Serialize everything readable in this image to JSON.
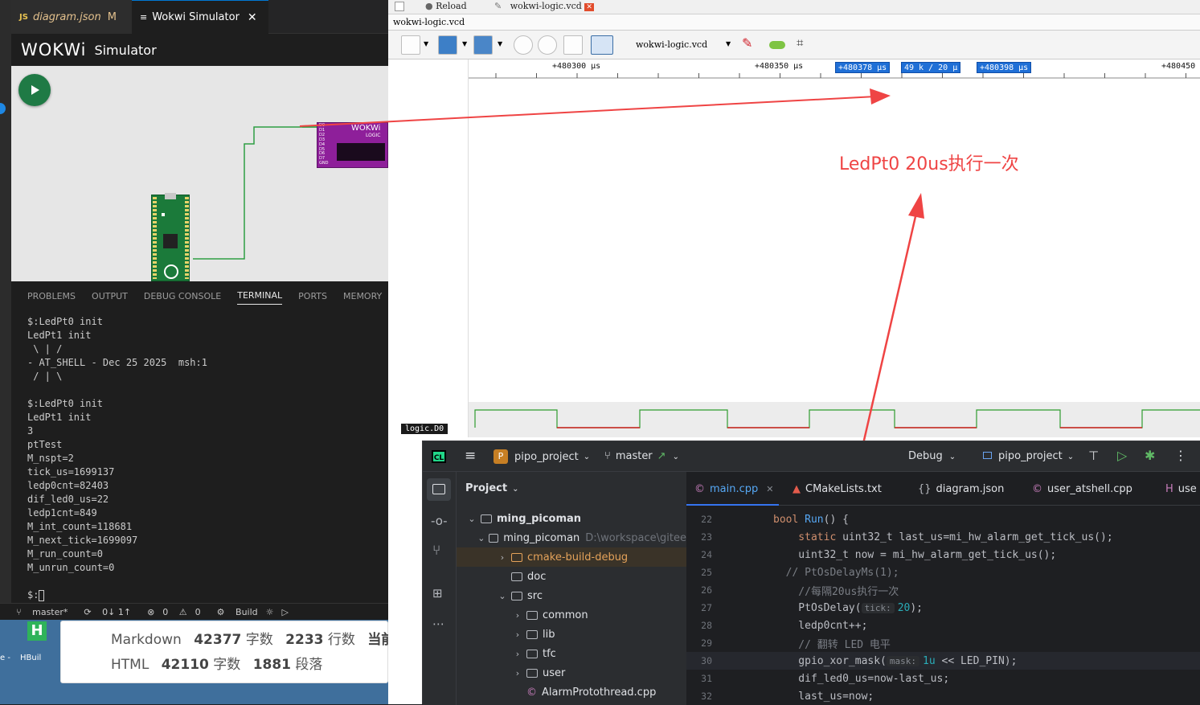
{
  "vscode": {
    "tabs": [
      {
        "badge": "JS",
        "label": "diagram.json",
        "status": "M"
      },
      {
        "label": "Wokwi Simulator"
      }
    ],
    "wokwi_logo": "WOKWi",
    "wokwi_title": "Simulator",
    "logic_chip_label": "WOKWi",
    "logic_chip_sub": "LOGIC",
    "logic_pins": [
      "D0",
      "D1",
      "D2",
      "D3",
      "D4",
      "D5",
      "D6",
      "D7",
      "GND"
    ],
    "panel_tabs": [
      "PROBLEMS",
      "OUTPUT",
      "DEBUG CONSOLE",
      "TERMINAL",
      "PORTS",
      "MEMORY"
    ],
    "terminal_lines": [
      "$:LedPt0 init",
      "LedPt1 init",
      " \\ | /",
      "- AT_SHELL - Dec 25 2025  msh:1",
      " / | \\",
      "",
      "$:LedPt0 init",
      "LedPt1 init",
      "3",
      "ptTest",
      "M_nspt=2",
      "tick_us=1699137",
      "ledp0cnt=82403",
      "dif_led0_us=22",
      "ledp1cnt=849",
      "M_int_count=118681",
      "M_next_tick=1699097",
      "M_run_count=0",
      "M_unrun_count=0",
      "",
      "$:"
    ],
    "status": {
      "branch": "master*",
      "sync": "0↓ 1↑",
      "errors": "0",
      "warnings": "0",
      "build": "Build"
    }
  },
  "desktop": {
    "app_label1": "e -",
    "app_label2": "HBuil",
    "stats_line1": {
      "k1": "Markdown",
      "v1": "42377",
      "u1": "字数",
      "v2": "2233",
      "u2": "行数",
      "tail": "当前行"
    },
    "stats_line2": {
      "k1": "HTML",
      "v1": "42110",
      "u1": "字数",
      "v2": "1881",
      "u2": "段落"
    }
  },
  "gtkwave": {
    "tab_reload": "Reload",
    "tab_file": "wokwi-logic.vcd",
    "title_file": "wokwi-logic.vcd",
    "toolbar_file": "wokwi-logic.vcd",
    "ruler_labels": [
      "+480300  μs",
      "+480350  μs",
      "+480450"
    ],
    "cursor_left": "+480378  μs",
    "cursor_delta": "49 k / 20  μ",
    "cursor_right": "+480398  μs",
    "signal_name": "logic.D0",
    "annotation": "LedPt0 20us执行一次",
    "colors": {
      "high": "#2e9b2e",
      "low": "#d02020",
      "arrow": "#ef4444",
      "cursor": "#1f6fd6"
    }
  },
  "clion": {
    "app_badge": "CL",
    "project_badge": "P",
    "project_name": "pipo_project",
    "branch": "master",
    "config": "Debug",
    "run_target": "pipo_project",
    "panel_title": "Project",
    "tree": [
      {
        "indent": 0,
        "chev": "⌄",
        "label": "ming_picoman",
        "bold": true
      },
      {
        "indent": 1,
        "chev": "⌄",
        "label": "ming_picoman",
        "path": "D:\\workspace\\gitee"
      },
      {
        "indent": 2,
        "chev": "›",
        "label": "cmake-build-debug",
        "color": "#e4a25a"
      },
      {
        "indent": 2,
        "chev": "",
        "label": "doc"
      },
      {
        "indent": 2,
        "chev": "⌄",
        "label": "src"
      },
      {
        "indent": 3,
        "chev": "›",
        "label": "common"
      },
      {
        "indent": 3,
        "chev": "›",
        "label": "lib"
      },
      {
        "indent": 3,
        "chev": "›",
        "label": "tfc"
      },
      {
        "indent": 3,
        "chev": "›",
        "label": "user"
      },
      {
        "indent": 3,
        "chev": "",
        "label": "AlarmProtothread.cpp",
        "file": true
      }
    ],
    "editor_tabs": [
      "main.cpp",
      "CMakeLists.txt",
      "diagram.json",
      "user_atshell.cpp",
      "use"
    ],
    "code_lines": [
      {
        "n": "22",
        "parts": [
          [
            "kw",
            "bool "
          ],
          [
            "fn",
            "Run"
          ],
          [
            "code",
            "() {"
          ]
        ]
      },
      {
        "n": "23",
        "parts": [
          [
            "kw",
            "    static "
          ],
          [
            "code",
            "uint32_t last_us=mi_hw_alarm_get_tick_us();"
          ]
        ]
      },
      {
        "n": "24",
        "parts": [
          [
            "code",
            "    uint32_t now = mi_hw_alarm_get_tick_us();"
          ]
        ]
      },
      {
        "n": "25",
        "parts": [
          [
            "cm",
            "  // PtOsDelayMs(1);"
          ]
        ]
      },
      {
        "n": "26",
        "parts": [
          [
            "cm",
            "    //每隔20us执行一次"
          ]
        ]
      },
      {
        "n": "27",
        "parts": [
          [
            "code",
            "    PtOsDelay("
          ],
          [
            "hint",
            "tick:"
          ],
          [
            "num",
            "20"
          ],
          [
            "code",
            ");"
          ]
        ]
      },
      {
        "n": "28",
        "parts": [
          [
            "code",
            "    ledp0cnt++;"
          ]
        ]
      },
      {
        "n": "29",
        "parts": [
          [
            "cm",
            "    // 翻转 LED 电平"
          ]
        ]
      },
      {
        "n": "30",
        "parts": [
          [
            "code",
            "    gpio_xor_mask("
          ],
          [
            "hint",
            "mask:"
          ],
          [
            "num",
            "1u"
          ],
          [
            "code",
            " << LED_PIN);"
          ]
        ]
      },
      {
        "n": "31",
        "parts": [
          [
            "code",
            "    dif_led0_us=now-last_us;"
          ]
        ]
      },
      {
        "n": "32",
        "parts": [
          [
            "code",
            "    last_us=now;"
          ]
        ]
      }
    ]
  }
}
